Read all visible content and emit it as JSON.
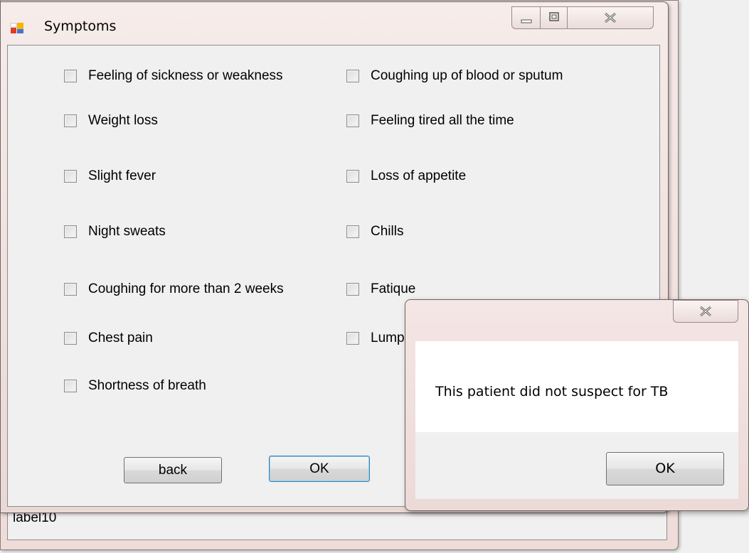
{
  "form": {
    "title": "Symptoms",
    "background_label": "label10"
  },
  "checkboxes": {
    "left": [
      {
        "label": "Feeling of sickness or weakness",
        "checked": false
      },
      {
        "label": "Weight loss",
        "checked": false
      },
      {
        "label": "Slight fever",
        "checked": false
      },
      {
        "label": "Night sweats",
        "checked": false
      },
      {
        "label": "Coughing for more than 2 weeks",
        "checked": false
      },
      {
        "label": "Chest pain",
        "checked": false
      },
      {
        "label": "Shortness of breath",
        "checked": false
      }
    ],
    "right": [
      {
        "label": "Coughing up of blood or sputum",
        "checked": false
      },
      {
        "label": "Feeling tired all the time",
        "checked": false
      },
      {
        "label": "Loss of appetite",
        "checked": false
      },
      {
        "label": "Chills",
        "checked": false
      },
      {
        "label": "Fatique",
        "checked": false
      },
      {
        "label": "Lump",
        "checked": false
      }
    ]
  },
  "buttons": {
    "back_label": "back",
    "ok_label": "OK"
  },
  "message_box": {
    "text": "This patient did not suspect for TB",
    "ok_label": "OK"
  },
  "colors": {
    "window_frame": "#f2e4e2",
    "client_bg": "#f0f0f0",
    "default_button_border": "#3c7fb1"
  },
  "icons": {
    "app": "form-app-icon",
    "minimize": "minimize-icon",
    "maximize": "maximize-icon",
    "close": "close-icon"
  }
}
